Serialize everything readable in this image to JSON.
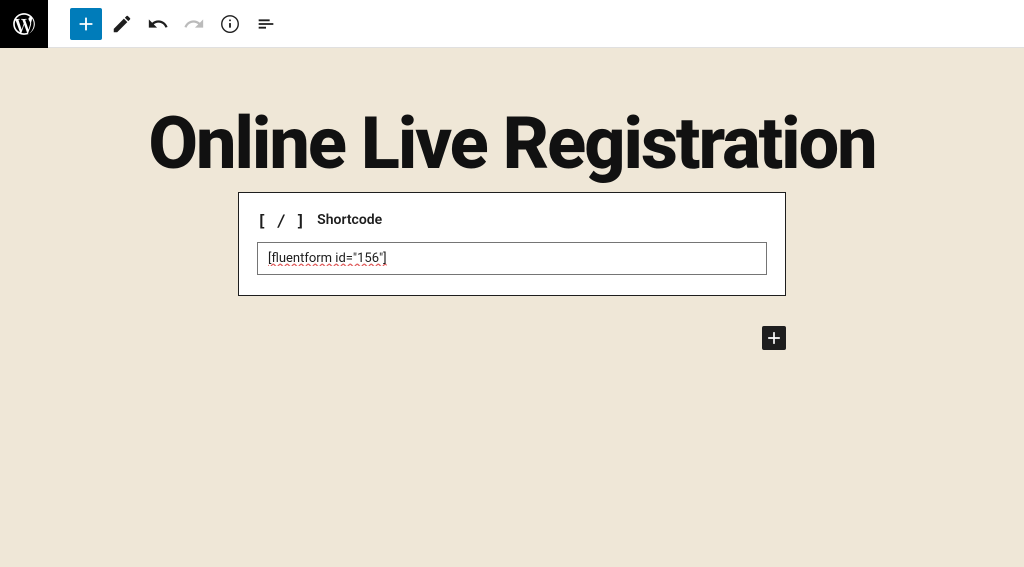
{
  "page": {
    "title": "Online Live Registration"
  },
  "shortcode_block": {
    "icon_text": "[ / ]",
    "label": "Shortcode",
    "value": "[fluentform id=\"156\"]"
  }
}
